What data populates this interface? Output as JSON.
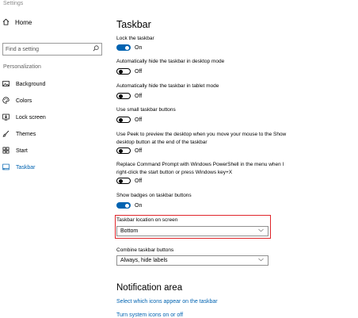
{
  "window": {
    "title": "Settings"
  },
  "sidebar": {
    "home_label": "Home",
    "search_placeholder": "Find a setting",
    "section_label": "Personalization",
    "items": [
      {
        "label": "Background",
        "icon": "image-icon",
        "active": false
      },
      {
        "label": "Colors",
        "icon": "palette-icon",
        "active": false
      },
      {
        "label": "Lock screen",
        "icon": "lock-screen-icon",
        "active": false
      },
      {
        "label": "Themes",
        "icon": "brush-icon",
        "active": false
      },
      {
        "label": "Start",
        "icon": "start-icon",
        "active": false
      },
      {
        "label": "Taskbar",
        "icon": "taskbar-icon",
        "active": true
      }
    ]
  },
  "main": {
    "title": "Taskbar",
    "settings": [
      {
        "label": "Lock the taskbar",
        "state": "On"
      },
      {
        "label": "Automatically hide the taskbar in desktop mode",
        "state": "Off"
      },
      {
        "label": "Automatically hide the taskbar in tablet mode",
        "state": "Off"
      },
      {
        "label": "Use small taskbar buttons",
        "state": "Off"
      },
      {
        "label": "Use Peek to preview the desktop when you move your mouse to the Show desktop button at the end of the taskbar",
        "state": "Off"
      },
      {
        "label": "Replace Command Prompt with Windows PowerShell in the menu when I right-click the start button or press Windows key+X",
        "state": "Off"
      },
      {
        "label": "Show badges on taskbar buttons",
        "state": "On"
      }
    ],
    "location": {
      "label": "Taskbar location on screen",
      "value": "Bottom"
    },
    "combine": {
      "label": "Combine taskbar buttons",
      "value": "Always, hide labels"
    },
    "notification": {
      "heading": "Notification area",
      "link1": "Select which icons appear on the taskbar",
      "link2": "Turn system icons on or off"
    }
  },
  "colors": {
    "accent": "#0063b1",
    "highlight": "#e0262b"
  }
}
